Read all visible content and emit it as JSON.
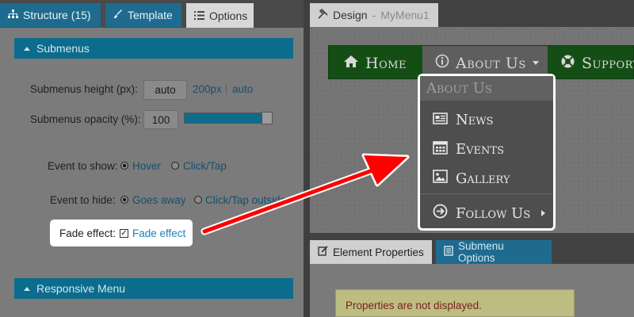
{
  "left_tabs": {
    "structure": "Structure (15)",
    "template": "Template",
    "options": "Options"
  },
  "submenus_section": {
    "title": "Submenus",
    "height_label": "Submenus height (px):",
    "height_value": "auto",
    "height_presets": [
      "200px",
      "auto"
    ],
    "opacity_label": "Submenus opacity (%):",
    "opacity_value": "100",
    "opacity_slider_percent": 100,
    "event_show_label": "Event to show:",
    "event_show_options": [
      "Hover",
      "Click/Tap"
    ],
    "event_show_selected": "Hover",
    "event_hide_label": "Event to hide:",
    "event_hide_options": [
      "Goes away",
      "Click/Tap outside"
    ],
    "event_hide_selected": "Goes away",
    "fade_label": "Fade effect:",
    "fade_checkbox_label": "Fade effect",
    "fade_checked": true
  },
  "responsive_section": {
    "title": "Responsive Menu"
  },
  "design_tab": {
    "label": "Design",
    "document": "MyMenu1"
  },
  "menu": {
    "items": [
      "Home",
      "About Us",
      "Support"
    ],
    "active": "About Us",
    "submenu": {
      "heading": "About Us",
      "items": [
        "News",
        "Events",
        "Gallery",
        "Follow Us"
      ]
    }
  },
  "bottom_tabs": {
    "element_properties": "Element Properties",
    "submenu_options": "Submenu Options"
  },
  "notice": "Properties are not displayed.",
  "colors": {
    "accent": "#0b6c8e",
    "menubar": "#154e15",
    "arrow": "#ff0000"
  }
}
